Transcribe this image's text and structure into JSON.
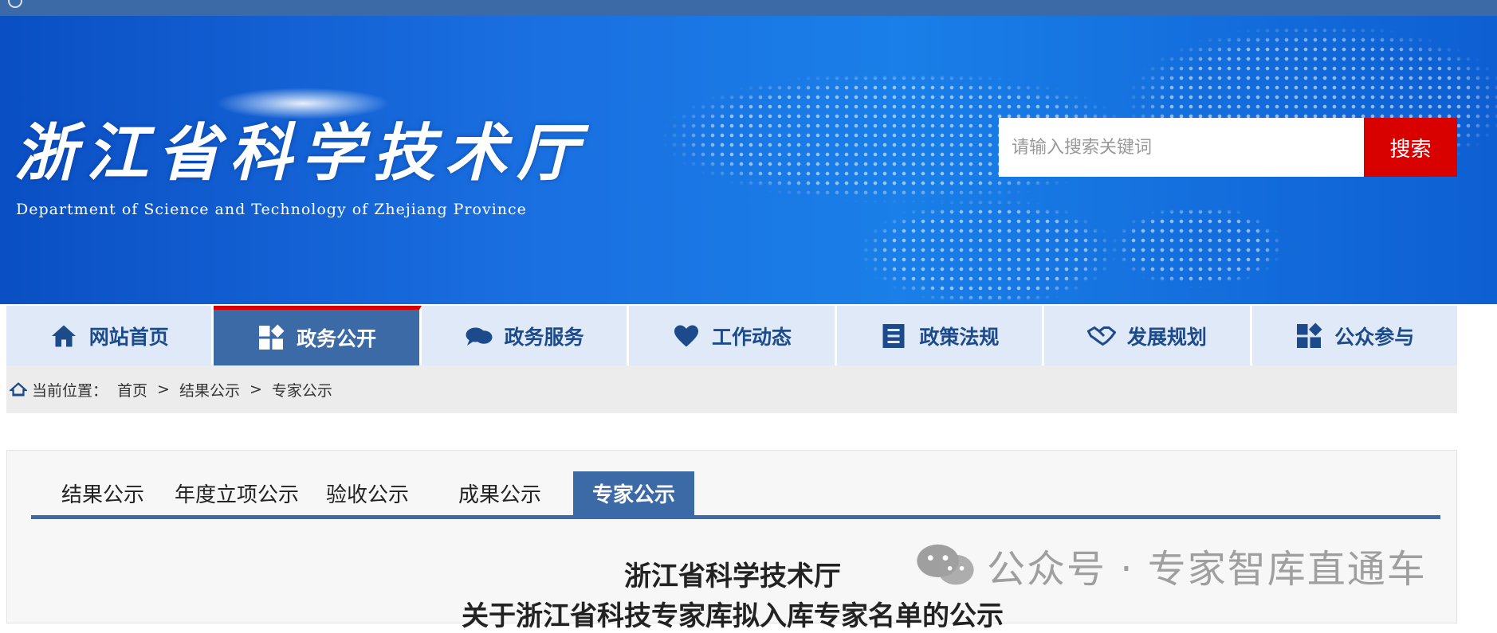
{
  "banner": {
    "logo_cn": "浙江省科学技术厅",
    "logo_en": "Department of Science and Technology of Zhejiang Province",
    "search_placeholder": "请输入搜索关键词",
    "search_button": "搜索"
  },
  "nav": {
    "items": [
      {
        "label": "网站首页",
        "icon": "home-icon"
      },
      {
        "label": "政务公开",
        "icon": "open-affairs-icon"
      },
      {
        "label": "政务服务",
        "icon": "chat-bubbles-icon"
      },
      {
        "label": "工作动态",
        "icon": "heart-icon"
      },
      {
        "label": "政策法规",
        "icon": "document-list-icon"
      },
      {
        "label": "发展规划",
        "icon": "handshake-icon"
      },
      {
        "label": "公众参与",
        "icon": "participation-icon"
      }
    ],
    "active_index": 1
  },
  "breadcrumb": {
    "prefix": "当前位置：",
    "items": [
      "首页",
      "结果公示",
      "专家公示"
    ],
    "separator": ">"
  },
  "tabs": {
    "items": [
      "结果公示",
      "年度立项公示",
      "验收公示",
      "成果公示",
      "专家公示"
    ],
    "active_index": 4
  },
  "document": {
    "title_line1": "浙江省科学技术厅",
    "title_line2": "关于浙江省科技专家库拟入库专家名单的公示"
  },
  "watermark": {
    "text": "公众号 · 专家智库直通车"
  },
  "colors": {
    "nav_active": "#3c6aa6",
    "accent_red": "#d90000",
    "nav_bg": "#dfe9f7"
  }
}
